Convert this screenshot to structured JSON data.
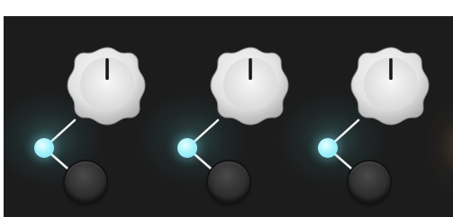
{
  "panel": {
    "background": "#1c1c1c"
  },
  "colors": {
    "knob_body": "#e6e6e6",
    "knob_indicator": "#1a1a1a",
    "link_dot": "#a6f2fb",
    "link_line": "#ffffff",
    "button": "#333333",
    "glow_teal": "#2f5c5e",
    "glow_warm": "#6a5533"
  },
  "channels": [
    {
      "knob": {
        "name": "knob-1",
        "icon": "rotary-knob"
      },
      "dot": {
        "name": "link-dot-1",
        "icon": "link-node"
      },
      "button": {
        "name": "round-button-1",
        "icon": "round-button"
      }
    },
    {
      "knob": {
        "name": "knob-2",
        "icon": "rotary-knob"
      },
      "dot": {
        "name": "link-dot-2",
        "icon": "link-node"
      },
      "button": {
        "name": "round-button-2",
        "icon": "round-button"
      }
    },
    {
      "knob": {
        "name": "knob-3",
        "icon": "rotary-knob"
      },
      "dot": {
        "name": "link-dot-3",
        "icon": "link-node"
      },
      "button": {
        "name": "round-button-3",
        "icon": "round-button"
      }
    }
  ]
}
